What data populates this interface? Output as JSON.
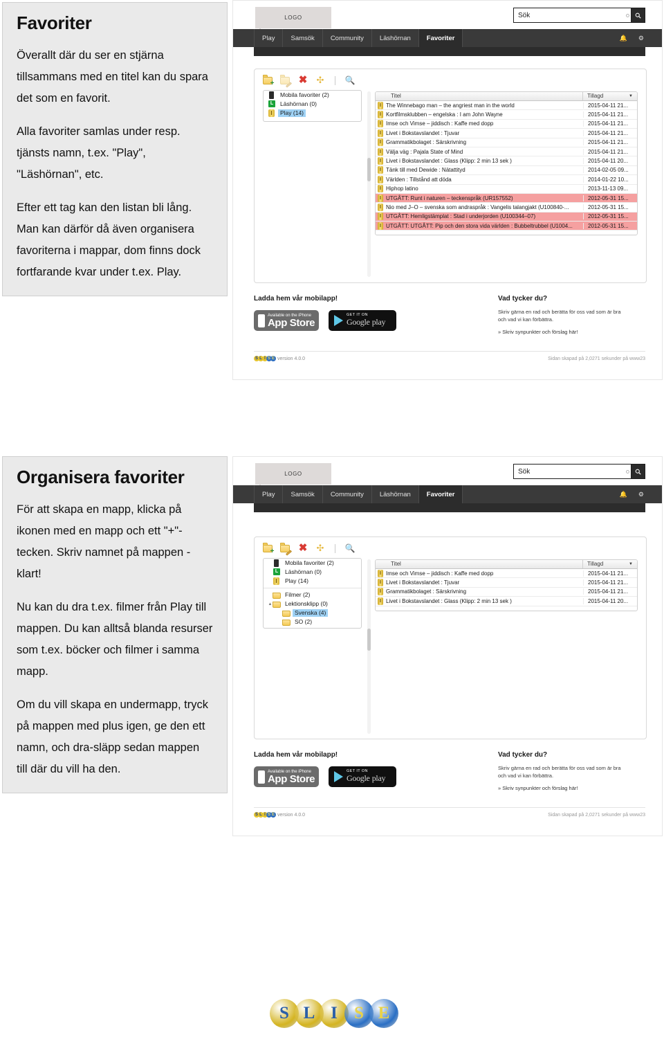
{
  "sections": [
    {
      "title": "Favoriter",
      "paragraphs": [
        "Överallt där du ser en stjärna tillsammans med en titel kan du spara det som en favorit.",
        "Alla favoriter samlas under resp. tjänsts namn, t.ex. \"Play\", \"Läshörnan\", etc.",
        "Efter ett tag kan den listan bli lång. Man kan därför då även organisera favoriterna i mappar, dom finns dock fortfarande kvar under t.ex. Play."
      ]
    },
    {
      "title": "Organisera favoriter",
      "paragraphs": [
        "För att skapa en mapp, klicka på ikonen med en mapp och ett \"+\"-tecken. Skriv namnet på mappen - klart!",
        "Nu kan du dra t.ex. filmer från Play till mappen. Du kan alltså blanda resurser som t.ex. böcker och filmer i samma mapp.",
        "Om du vill skapa en undermapp, tryck på mappen med plus igen, ge den ett namn, och dra-släpp sedan mappen till där du vill ha den."
      ]
    }
  ],
  "browser": {
    "logo_label": "LOGO",
    "search": {
      "value": "Sök",
      "placeholder": "Sök",
      "button_icon": "search-icon"
    },
    "nav_tabs": [
      {
        "label": "Play",
        "active": false
      },
      {
        "label": "Samsök",
        "active": false
      },
      {
        "label": "Community",
        "active": false
      },
      {
        "label": "Läshörnan",
        "active": false
      },
      {
        "label": "Favoriter",
        "active": true
      }
    ],
    "nav_right_icons": [
      "bell-icon",
      "gear-icon"
    ],
    "toolbar_icons": [
      "new-folder-icon",
      "rename-folder-icon",
      "delete-icon",
      "move-icon",
      "separator",
      "search-icon"
    ],
    "list_headers": {
      "title": "Titel",
      "added": "Tillagd",
      "sort_icon": "chevron-down-icon"
    },
    "footer": {
      "mobile_heading": "Ladda hem vår mobilapp!",
      "appstore": {
        "top": "Available on the iPhone",
        "main": "App Store"
      },
      "googleplay": {
        "top": "GET IT ON",
        "main": "Google",
        "sub": "play"
      },
      "feedback_heading": "Vad tycker du?",
      "feedback_text": "Skriv gärna en rad och berätta för oss vad som är bra och vad vi kan förbättra.",
      "feedback_link": "» Skriv synpunkter och förslag här!",
      "version": "version 4.0.0",
      "server": "Sidan skapad på 2,0271 sekunder på www23"
    }
  },
  "shot1": {
    "tree": [
      {
        "label": "Mobila favoriter (2)",
        "icon": "mobile-icon",
        "selected": false,
        "indent": 0
      },
      {
        "label": "Läshörnan (0)",
        "icon": "green-book-icon",
        "selected": false,
        "indent": 0
      },
      {
        "label": "Play (14)",
        "icon": "coin-icon",
        "selected": true,
        "indent": 0
      }
    ],
    "rows": [
      {
        "title": "The Winnebago man – the angriest man in the world",
        "date": "2015-04-11 21...",
        "expired": false
      },
      {
        "title": "Kortfilmsklubben – engelska : I am John Wayne",
        "date": "2015-04-11 21...",
        "expired": false
      },
      {
        "title": "Imse och Vimse – jiddisch : Kaffe med dopp",
        "date": "2015-04-11 21...",
        "expired": false
      },
      {
        "title": "Livet i Bokstavslandet : Tjuvar",
        "date": "2015-04-11 21...",
        "expired": false
      },
      {
        "title": "Grammatikbolaget : Särskrivning",
        "date": "2015-04-11 21...",
        "expired": false
      },
      {
        "title": "Välja väg : Pajala State of Mind",
        "date": "2015-04-11 21...",
        "expired": false
      },
      {
        "title": "Livet i Bokstavslandet : Glass (Klipp: 2 min 13 sek )",
        "date": "2015-04-11 20...",
        "expired": false
      },
      {
        "title": "Tänk till med Dewide : Nätattityd",
        "date": "2014-02-05 09...",
        "expired": false
      },
      {
        "title": "Världen : Tillstånd att döda",
        "date": "2014-01-22 10...",
        "expired": false
      },
      {
        "title": "Hiphop latino",
        "date": "2013-11-13 09...",
        "expired": false
      },
      {
        "title": "UTGÅTT: Runt i naturen – teckenspråk (UR157552)",
        "date": "2012-05-31 15...",
        "expired": true
      },
      {
        "title": "Nio med J–O – svenska som andraspråk : Vangelis talangjakt (U100840-...",
        "date": "2012-05-31 15...",
        "expired": false
      },
      {
        "title": "UTGÅTT: Hemligstämplat : Stad i underjorden (U100344–07)",
        "date": "2012-05-31 15...",
        "expired": true
      },
      {
        "title": "UTGÅTT: UTGÅTT: Pip och den stora vida världen : Bubbeltrubbel (U1004...",
        "date": "2012-05-31 15...",
        "expired": true
      }
    ]
  },
  "shot2": {
    "tree": [
      {
        "label": "Mobila favoriter (2)",
        "icon": "mobile-icon",
        "selected": false,
        "indent": 0,
        "twisty": ""
      },
      {
        "label": "Läshörnan (0)",
        "icon": "green-book-icon",
        "selected": false,
        "indent": 0,
        "twisty": ""
      },
      {
        "label": "Play (14)",
        "icon": "coin-icon",
        "selected": false,
        "indent": 0,
        "twisty": ""
      },
      {
        "divider": true
      },
      {
        "label": "Filmer (2)",
        "icon": "folder-icon",
        "selected": false,
        "indent": 0,
        "twisty": ""
      },
      {
        "label": "Lektionsklipp (0)",
        "icon": "folder-icon",
        "selected": false,
        "indent": 0,
        "twisty": "▲"
      },
      {
        "label": "Svenska (4)",
        "icon": "folder-icon",
        "selected": true,
        "indent": 1,
        "twisty": ""
      },
      {
        "label": "SO (2)",
        "icon": "folder-icon",
        "selected": false,
        "indent": 1,
        "twisty": ""
      }
    ],
    "rows": [
      {
        "title": "Imse och Vimse – jiddisch : Kaffe med dopp",
        "date": "2015-04-11 21...",
        "expired": false
      },
      {
        "title": "Livet i Bokstavslandet : Tjuvar",
        "date": "2015-04-11 21...",
        "expired": false
      },
      {
        "title": "Grammatikbolaget : Särskrivning",
        "date": "2015-04-11 21...",
        "expired": false
      },
      {
        "title": "Livet i Bokstavslandet : Glass (Klipp: 2 min 13 sek )",
        "date": "2015-04-11 20...",
        "expired": false
      }
    ]
  },
  "brand": {
    "letters": [
      "S",
      "L",
      "I",
      "S",
      "E"
    ],
    "colors": [
      "#d4b421",
      "#d4b421",
      "#d4b421",
      "#2a6fc4",
      "#2a6fc4"
    ],
    "text_colors": [
      "#2b5fa8",
      "#2b5fa8",
      "#2b5fa8",
      "#e8d24a",
      "#e8d24a"
    ]
  }
}
